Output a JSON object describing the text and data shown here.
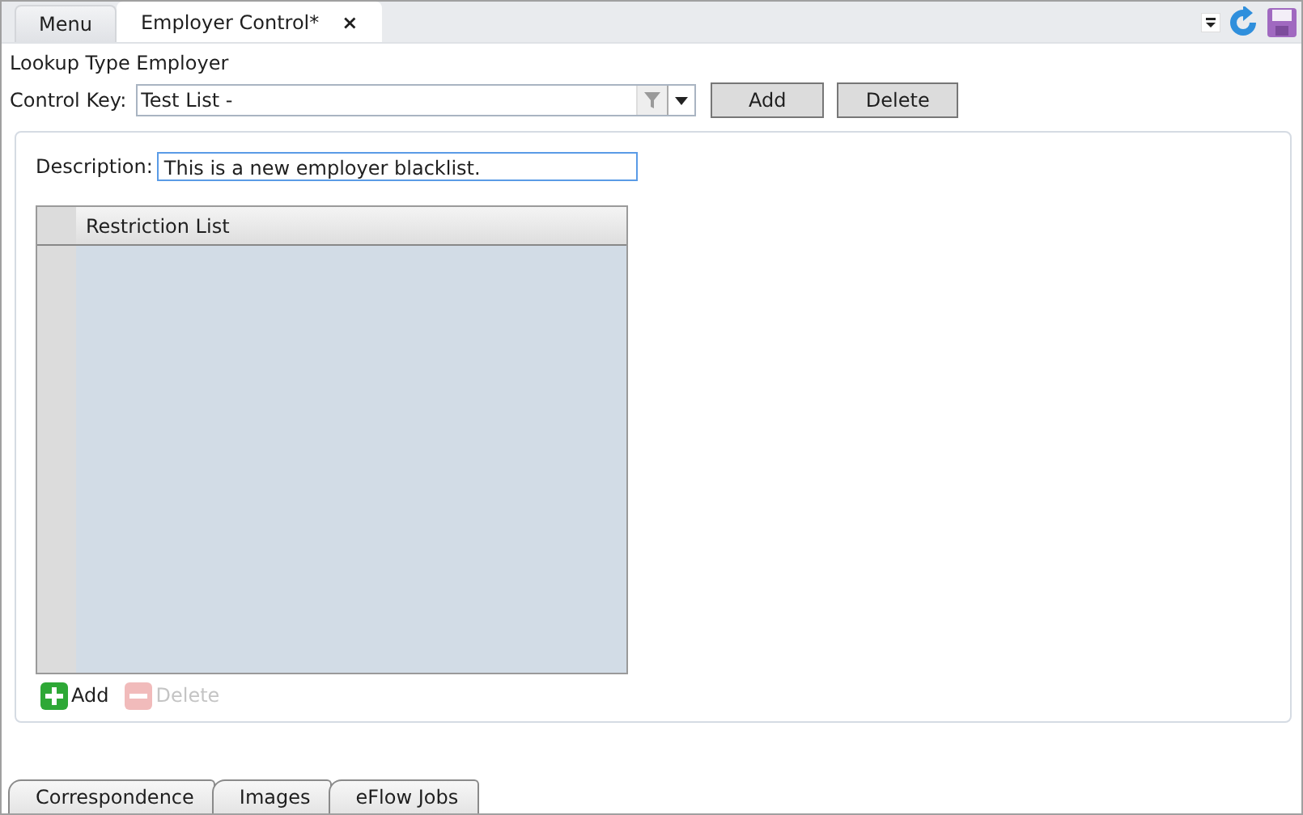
{
  "tabs": [
    {
      "label": "Menu",
      "selected": false
    },
    {
      "label": "Employer Control*",
      "selected": true,
      "close": "×"
    }
  ],
  "lookup_type": "Lookup Type Employer",
  "control_key": {
    "label": "Control Key:",
    "value": "Test List -"
  },
  "buttons": [
    "Add",
    "Delete"
  ],
  "description": {
    "label": "Description:",
    "value": "This is a new employer blacklist."
  },
  "grid": {
    "columns": [
      "Restriction List"
    ]
  },
  "grid_actions": [
    {
      "kind": "add",
      "label": "Add",
      "disabled": false
    },
    {
      "kind": "delete",
      "label": "Delete",
      "disabled": true
    }
  ],
  "bottom_tabs": [
    {
      "label": "Correspondence",
      "selected": false
    },
    {
      "label": "Images",
      "selected": false
    },
    {
      "label": "eFlow Jobs",
      "selected": false
    }
  ]
}
